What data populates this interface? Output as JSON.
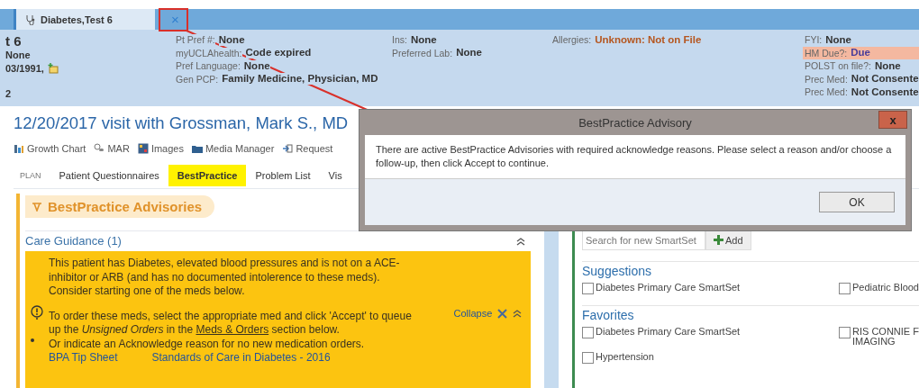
{
  "patient_tab": {
    "label": "Diabetes,Test 6",
    "close": "×"
  },
  "header": {
    "left": [
      {
        "text": "t 6",
        "kind": "name"
      },
      {
        "text": "None",
        "kind": "plain"
      },
      {
        "text": "03/1991,",
        "kind": "date"
      },
      {
        "text": "2",
        "kind": "plain"
      }
    ],
    "columns": [
      [
        {
          "label": "Pt Pref #:",
          "value": "None",
          "kind": "plain",
          "highlight": false
        },
        {
          "label": "myUCLAhealth:",
          "value": "Code expired",
          "kind": "plain",
          "highlight": false
        },
        {
          "label": "Pref Language:",
          "value": "None",
          "kind": "plain",
          "highlight": false
        },
        {
          "label": "Gen PCP:",
          "value": "Family Medicine, Physician, MD",
          "kind": "plain",
          "highlight": false
        }
      ],
      [
        {
          "label": "Ins:",
          "value": "None",
          "kind": "plain",
          "highlight": false
        },
        {
          "label": "Preferred Lab:",
          "value": "None",
          "kind": "plain",
          "highlight": false
        }
      ],
      [
        {
          "label": "Allergies:",
          "value": "Unknown: Not on File",
          "kind": "alert",
          "highlight": false
        }
      ],
      [
        {
          "label": "FYI:",
          "value": "None",
          "kind": "plain",
          "highlight": false
        },
        {
          "label": "HM Due?:",
          "value": "Due",
          "kind": "due",
          "highlight": true
        },
        {
          "label": "POLST on file?:",
          "value": "None",
          "kind": "plain",
          "highlight": false
        },
        {
          "label": "Prec Med:",
          "value": "Not Consente",
          "kind": "plain",
          "highlight": false
        },
        {
          "label": "Prec Med:",
          "value": "Not Consente",
          "kind": "plain",
          "highlight": false
        }
      ]
    ]
  },
  "visit_title": "12/20/2017 visit with Grossman, Mark S., MD",
  "toolbar": [
    {
      "label": "Growth Chart"
    },
    {
      "label": "MAR"
    },
    {
      "label": "Images"
    },
    {
      "label": "Media Manager"
    },
    {
      "label": "Request"
    }
  ],
  "section_label": "PLAN",
  "tabs": [
    {
      "label": "Patient Questionnaires",
      "selected": false
    },
    {
      "label": "BestPractice",
      "selected": true
    },
    {
      "label": "Problem List",
      "selected": false
    },
    {
      "label": "Vis",
      "selected": false
    }
  ],
  "advisories": {
    "title": "BestPractice Advisories",
    "group": "Care Guidance (1)",
    "card": {
      "paragraph": "This patient has Diabetes, elevated blood pressures and is not on a ACE-inhibitor or ARB (and has no documented intolerence to these meds). Consider starting one of the meds below.",
      "instruction_before": "To order these meds, select the appropriate med and click 'Accept' to queue up the *Unsigned Orders* in the",
      "instruction_link": "Meds & Orders",
      "instruction_after": "section below.",
      "bullet": "Or indicate an Acknowledge reason for no new medication orders.",
      "links": [
        "BPA Tip Sheet",
        "Standards of Care in Diabetes - 2016"
      ],
      "collapse": "Collapse"
    }
  },
  "smartsets": {
    "search_placeholder": "Search for new SmartSet",
    "add": "Add",
    "groups": [
      {
        "title": "Suggestions",
        "items": [
          {
            "label": "Diabetes Primary Care SmartSet",
            "checked": false
          },
          {
            "label": "Pediatric Blood",
            "checked": false
          }
        ]
      },
      {
        "title": "Favorites",
        "items": [
          {
            "label": "Diabetes Primary Care SmartSet",
            "checked": false
          },
          {
            "label": "RIS CONNIE F\nIMAGING",
            "checked": false
          },
          {
            "label": "Hypertension",
            "checked": false
          }
        ]
      }
    ]
  },
  "dialog": {
    "title": "BestPractice Advisory",
    "close": "x",
    "message": "There are active BestPractice Advisories with required acknowledge reasons. Please select a reason and/or choose a follow-up, then click Accept to continue.",
    "button": "OK"
  }
}
